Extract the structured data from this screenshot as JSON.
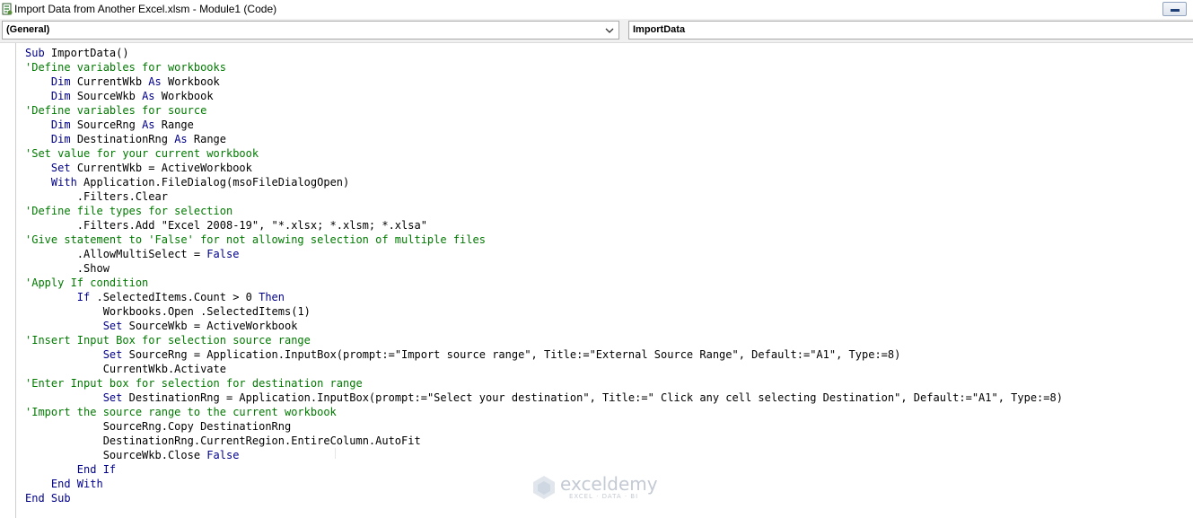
{
  "window": {
    "title": "Import Data from Another Excel.xlsm - Module1 (Code)"
  },
  "combos": {
    "object": "(General)",
    "procedure": "ImportData"
  },
  "colors": {
    "keyword": "#00008b",
    "comment": "#007a00",
    "text": "#000000"
  },
  "watermark": {
    "name": "exceldemy",
    "tagline": "EXCEL · DATA · BI"
  },
  "code_lines": [
    {
      "indent": "",
      "tokens": [
        {
          "k": "kw",
          "t": "Sub"
        },
        {
          "k": "tx",
          "t": " ImportData()"
        }
      ]
    },
    {
      "indent": "",
      "tokens": [
        {
          "k": "cm",
          "t": "'Define variables for workbooks"
        }
      ]
    },
    {
      "indent": "    ",
      "tokens": [
        {
          "k": "kw",
          "t": "Dim"
        },
        {
          "k": "tx",
          "t": " CurrentWkb "
        },
        {
          "k": "kw",
          "t": "As"
        },
        {
          "k": "tx",
          "t": " Workbook"
        }
      ]
    },
    {
      "indent": "    ",
      "tokens": [
        {
          "k": "kw",
          "t": "Dim"
        },
        {
          "k": "tx",
          "t": " SourceWkb "
        },
        {
          "k": "kw",
          "t": "As"
        },
        {
          "k": "tx",
          "t": " Workbook"
        }
      ]
    },
    {
      "indent": "",
      "tokens": [
        {
          "k": "cm",
          "t": "'Define variables for source"
        }
      ]
    },
    {
      "indent": "    ",
      "tokens": [
        {
          "k": "kw",
          "t": "Dim"
        },
        {
          "k": "tx",
          "t": " SourceRng "
        },
        {
          "k": "kw",
          "t": "As"
        },
        {
          "k": "tx",
          "t": " Range"
        }
      ]
    },
    {
      "indent": "    ",
      "tokens": [
        {
          "k": "kw",
          "t": "Dim"
        },
        {
          "k": "tx",
          "t": " DestinationRng "
        },
        {
          "k": "kw",
          "t": "As"
        },
        {
          "k": "tx",
          "t": " Range"
        }
      ]
    },
    {
      "indent": "",
      "tokens": [
        {
          "k": "cm",
          "t": "'Set value for your current workbook"
        }
      ]
    },
    {
      "indent": "    ",
      "tokens": [
        {
          "k": "kw",
          "t": "Set"
        },
        {
          "k": "tx",
          "t": " CurrentWkb = ActiveWorkbook"
        }
      ]
    },
    {
      "indent": "    ",
      "tokens": [
        {
          "k": "kw",
          "t": "With"
        },
        {
          "k": "tx",
          "t": " Application.FileDialog(msoFileDialogOpen)"
        }
      ]
    },
    {
      "indent": "        ",
      "tokens": [
        {
          "k": "tx",
          "t": ".Filters.Clear"
        }
      ]
    },
    {
      "indent": "",
      "tokens": [
        {
          "k": "cm",
          "t": "'Define file types for selection"
        }
      ]
    },
    {
      "indent": "        ",
      "tokens": [
        {
          "k": "tx",
          "t": ".Filters.Add \"Excel 2008-19\", \"*.xlsx; *.xlsm; *.xlsa\""
        }
      ]
    },
    {
      "indent": "",
      "tokens": [
        {
          "k": "cm",
          "t": "'Give statement to 'False' for not allowing selection of multiple files"
        }
      ]
    },
    {
      "indent": "        ",
      "tokens": [
        {
          "k": "tx",
          "t": ".AllowMultiSelect = "
        },
        {
          "k": "kw",
          "t": "False"
        }
      ]
    },
    {
      "indent": "        ",
      "tokens": [
        {
          "k": "tx",
          "t": ".Show"
        }
      ]
    },
    {
      "indent": "",
      "tokens": [
        {
          "k": "cm",
          "t": "'Apply If condition"
        }
      ]
    },
    {
      "indent": "        ",
      "tokens": [
        {
          "k": "kw",
          "t": "If"
        },
        {
          "k": "tx",
          "t": " .SelectedItems.Count > 0 "
        },
        {
          "k": "kw",
          "t": "Then"
        }
      ]
    },
    {
      "indent": "            ",
      "tokens": [
        {
          "k": "tx",
          "t": "Workbooks.Open .SelectedItems(1)"
        }
      ]
    },
    {
      "indent": "            ",
      "tokens": [
        {
          "k": "kw",
          "t": "Set"
        },
        {
          "k": "tx",
          "t": " SourceWkb = ActiveWorkbook"
        }
      ]
    },
    {
      "indent": "",
      "tokens": [
        {
          "k": "cm",
          "t": "'Insert Input Box for selection source range"
        }
      ]
    },
    {
      "indent": "            ",
      "tokens": [
        {
          "k": "kw",
          "t": "Set"
        },
        {
          "k": "tx",
          "t": " SourceRng = Application.InputBox(prompt:=\"Import source range\", Title:=\"External Source Range\", Default:=\"A1\", Type:=8)"
        }
      ]
    },
    {
      "indent": "            ",
      "tokens": [
        {
          "k": "tx",
          "t": "CurrentWkb.Activate"
        }
      ]
    },
    {
      "indent": "",
      "tokens": [
        {
          "k": "cm",
          "t": "'Enter Input box for selection for destination range"
        }
      ]
    },
    {
      "indent": "            ",
      "tokens": [
        {
          "k": "kw",
          "t": "Set"
        },
        {
          "k": "tx",
          "t": " DestinationRng = Application.InputBox(prompt:=\"Select your destination\", Title:=\" Click any cell selecting Destination\", Default:=\"A1\", Type:=8)"
        }
      ]
    },
    {
      "indent": "",
      "tokens": [
        {
          "k": "cm",
          "t": "'Import the source range to the current workbook"
        }
      ]
    },
    {
      "indent": "            ",
      "tokens": [
        {
          "k": "tx",
          "t": "SourceRng.Copy DestinationRng"
        }
      ]
    },
    {
      "indent": "            ",
      "tokens": [
        {
          "k": "tx",
          "t": "DestinationRng.CurrentRegion.EntireColumn.AutoFit"
        }
      ]
    },
    {
      "indent": "            ",
      "tokens": [
        {
          "k": "tx",
          "t": "SourceWkb.Close "
        },
        {
          "k": "kw",
          "t": "False"
        }
      ]
    },
    {
      "indent": "        ",
      "tokens": [
        {
          "k": "kw",
          "t": "End If"
        }
      ]
    },
    {
      "indent": "    ",
      "tokens": [
        {
          "k": "kw",
          "t": "End With"
        }
      ]
    },
    {
      "indent": "",
      "tokens": [
        {
          "k": "kw",
          "t": "End Sub"
        }
      ]
    }
  ]
}
